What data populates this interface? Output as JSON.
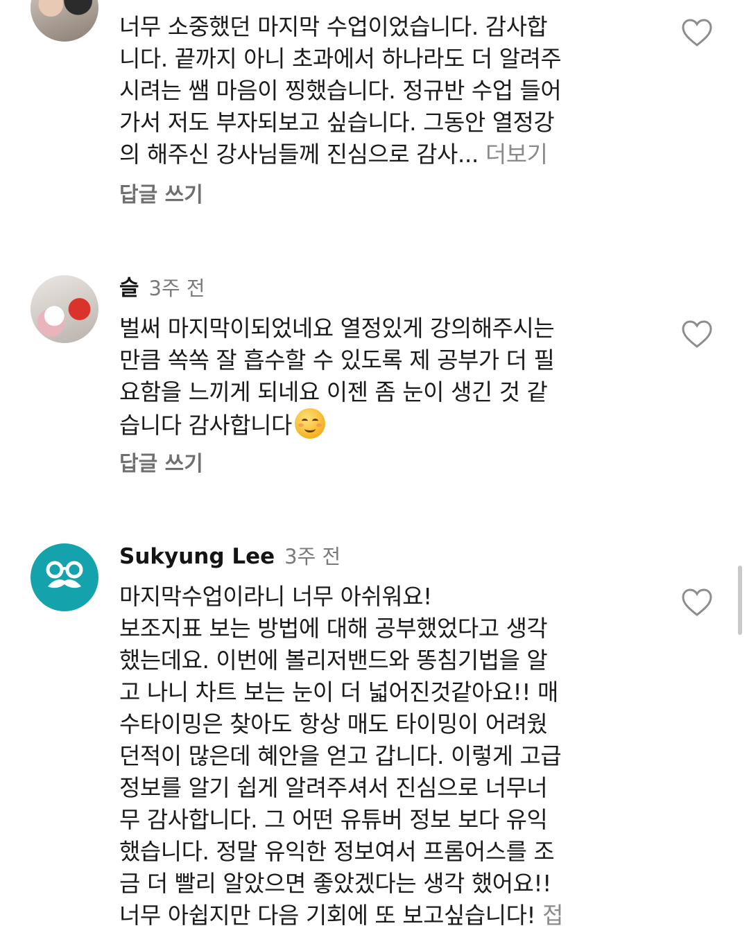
{
  "comments": [
    {
      "author": "",
      "time": "",
      "text": "너무 소중했던 마지막 수업이었습니다. 감사합\n니다. 끝까지 아니 초과에서 하나라도 더 알려주\n시려는 쌤 마음이 찡했습니다. 정규반 수업 들어\n가서 저도 부자되보고 싶습니다. 그동안 열정강\n의 해주신 강사님들께 진심으로 감사...",
      "more_label": "더보기",
      "reply_label": "답글 쓰기"
    },
    {
      "author": "슬",
      "time": "3주 전",
      "text": "벌써 마지막이되었네요 열정있게 강의해주시는\n만큼 쏙쏙 잘 흡수할 수 있도록 제 공부가 더 필\n요함을 느끼게 되네요 이젠 좀 눈이 생긴 것 같\n습니다 감사합니다",
      "reply_label": "답글 쓰기"
    },
    {
      "author": "Sukyung Lee",
      "time": "3주 전",
      "text": "마지막수업이라니 너무 아쉬워요!\n보조지표 보는 방법에 대해 공부했었다고 생각\n했는데요. 이번에 볼리저밴드와 똥침기법을 알\n고 나니 차트 보는 눈이 더 넓어진것같아요!! 매\n수타이밍은 찾아도 항상 매도 타이밍이 어려웠\n던적이 많은데 혜안을 얻고 갑니다. 이렇게 고급\n정보를 알기 쉽게 알려주셔서 진심으로 너무너\n무 감사합니다. 그 어떤 유튜버 정보 보다 유익\n했습니다. 정말 유익한 정보여서 프롬어스를 조\n금 더 빨리 알았으면 좋았겠다는 생각 했어요!!\n너무 아쉽지만 다음 기회에 또 보고싶습니다!",
      "more_label": "접"
    }
  ],
  "colors": {
    "accent_avatar": "#14a2ad",
    "meta": "#7a7a7a"
  },
  "icons": {
    "like": "heart-outline-icon",
    "avatar3": "glasses-mustache-icon"
  }
}
